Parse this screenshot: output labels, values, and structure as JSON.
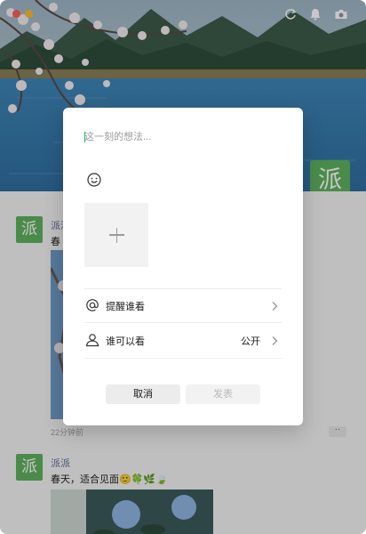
{
  "window": {
    "controls": [
      "close",
      "minimize"
    ]
  },
  "top_icons": [
    "refresh-icon",
    "bell-icon",
    "camera-icon"
  ],
  "profile": {
    "avatar_text": "派"
  },
  "feed": {
    "posts": [
      {
        "author": "派派",
        "text": "春",
        "time": "22分钟前",
        "avatar_text": "派"
      },
      {
        "author": "派派",
        "text": "春天，适合见面🙂🍀🌿🍃",
        "avatar_text": "派"
      }
    ]
  },
  "compose": {
    "placeholder": "这一刻的想法...",
    "emoji_icon": "smile-icon",
    "add_media_icon": "plus-icon",
    "options": [
      {
        "icon": "at-icon",
        "label": "提醒谁看",
        "value": ""
      },
      {
        "icon": "person-icon",
        "label": "谁可以看",
        "value": "公开"
      }
    ],
    "cancel_label": "取消",
    "publish_label": "发表"
  },
  "colors": {
    "accent": "#07c160",
    "avatar_green": "#5fb35f",
    "link_blue": "#5b6b91"
  }
}
